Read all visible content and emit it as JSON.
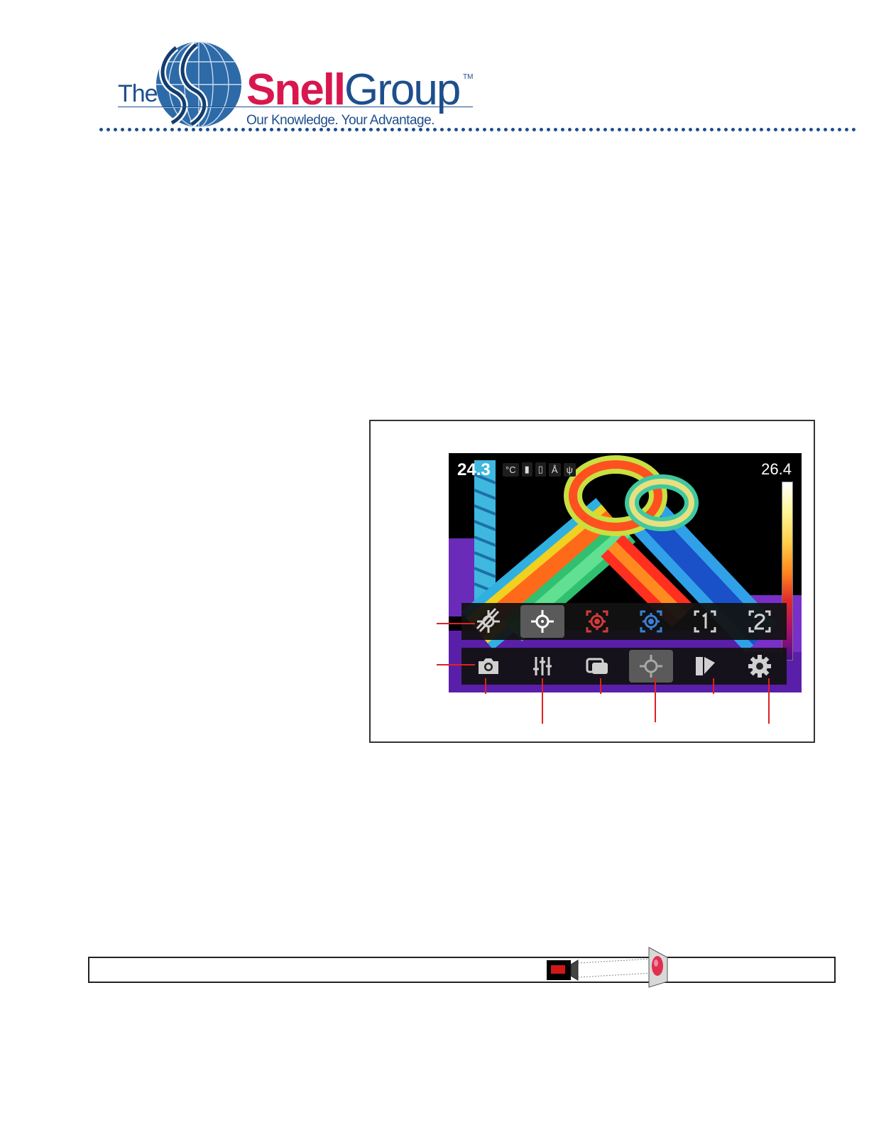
{
  "header": {
    "logo_the": "The",
    "logo_snell": "Snell",
    "logo_group": "Group",
    "logo_tm": "TM",
    "logo_tagline": "Our Knowledge. Your Advantage."
  },
  "camera_screen": {
    "current_temp": "24.3",
    "unit": "°C",
    "max_temp": "26.4",
    "status_icons": [
      "battery-icon",
      "sd-card-icon",
      "bluetooth-icon",
      "usb-icon"
    ],
    "measurement_row": [
      "measurement-off-icon",
      "center-spot-icon",
      "hot-spot-icon",
      "cold-spot-icon",
      "user-spot-1-icon",
      "user-spot-2-icon"
    ],
    "main_row": [
      "camera-icon",
      "sliders-icon",
      "image-mode-icon",
      "measurement-icon",
      "palette-icon",
      "settings-icon"
    ]
  },
  "colors": {
    "brand_blue": "#1d4f8c",
    "brand_red": "#d8174f",
    "callout_red": "#d22222",
    "hot_spot_red": "#d43a3a",
    "cold_spot_blue": "#3a7fd4"
  }
}
